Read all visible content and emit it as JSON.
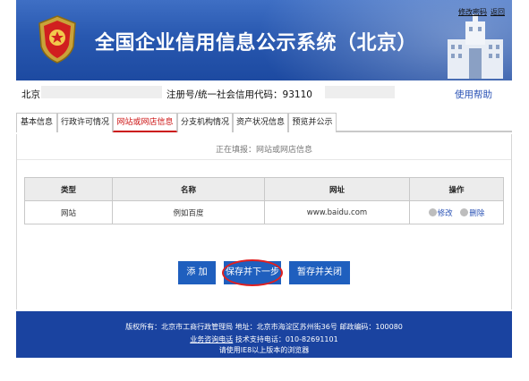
{
  "header": {
    "title": "全国企业信用信息公示系统（北京）",
    "links": [
      "修改密码",
      "返回"
    ]
  },
  "info": {
    "city": "北京",
    "reg_label": "注册号/统一社会信用代码：93110",
    "help": "使用帮助"
  },
  "tabs": [
    "基本信息",
    "行政许可情况",
    "网站或网店信息",
    "分支机构情况",
    "资产状况信息",
    "预览并公示"
  ],
  "content": {
    "location": "正在填报：网站或网店信息",
    "table": {
      "headers": [
        "类型",
        "名称",
        "网址",
        "操作"
      ],
      "rows": [
        {
          "type": "网站",
          "name": "例如百度",
          "url": "www.baidu.com",
          "edit": "修改",
          "delete": "删除"
        }
      ]
    },
    "buttons": {
      "add": "添 加",
      "save_next": "保存并下一步",
      "save_close": "暂存并关闭"
    }
  },
  "footer": {
    "line1": "版权所有：北京市工商行政管理局   地址：北京市海淀区苏州街36号   邮政编码：100080",
    "line2_link": "业务咨询电话",
    "line2_rest": "   技术支持电话：010-82691101",
    "line3": "请使用IE8以上版本的浏览器"
  },
  "colors": {
    "header_blue": "#2858b0",
    "button_blue": "#1f5fbe",
    "footer_blue": "#1a43a0",
    "active_tab": "#cc1111",
    "highlight_oval": "#e02020"
  }
}
